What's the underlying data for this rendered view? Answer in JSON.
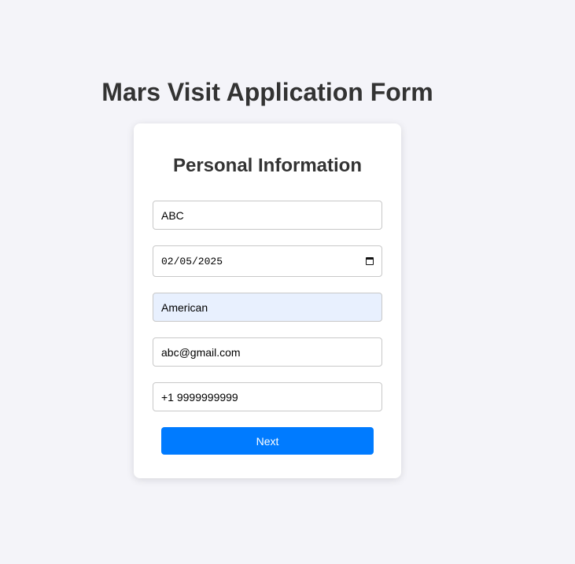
{
  "page": {
    "title": "Mars Visit Application Form"
  },
  "form": {
    "section_title": "Personal Information",
    "name_value": "ABC",
    "dob_value": "02/05/2025",
    "nationality_value": "American",
    "email_value": "abc@gmail.com",
    "phone_value": "+1 9999999999",
    "next_label": "Next"
  },
  "icons": {
    "date_picker": "calendar-icon"
  },
  "colors": {
    "background": "#f4f4f9",
    "card": "#ffffff",
    "button": "#007bff",
    "autofill": "#e8f0fe",
    "heading": "#333333"
  }
}
